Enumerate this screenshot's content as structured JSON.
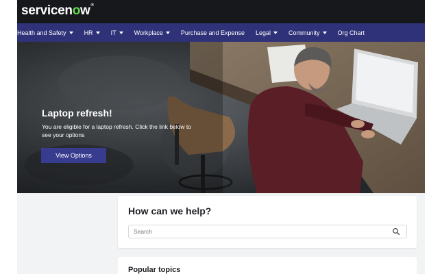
{
  "brand": {
    "name_prefix": "servicen",
    "name_o": "o",
    "name_suffix": "w",
    "mark": "®"
  },
  "nav": {
    "items": [
      {
        "label": "Health and Safety",
        "dropdown": true
      },
      {
        "label": "HR",
        "dropdown": true
      },
      {
        "label": "IT",
        "dropdown": true
      },
      {
        "label": "Workplace",
        "dropdown": true
      },
      {
        "label": "Purchase and Expense",
        "dropdown": false
      },
      {
        "label": "Legal",
        "dropdown": true
      },
      {
        "label": "Community",
        "dropdown": true
      },
      {
        "label": "Org Chart",
        "dropdown": false
      }
    ]
  },
  "hero": {
    "title": "Laptop refresh!",
    "text": "You are eligible for a laptop refresh. Click the link below to see your options",
    "button_label": "View Options"
  },
  "help": {
    "title": "How can we help?",
    "search_placeholder": "Search"
  },
  "topics": {
    "title": "Popular topics"
  },
  "colors": {
    "topbar": "#17181c",
    "nav": "#2f3278",
    "button": "#383c8e",
    "logo_accent": "#62d84e",
    "page_bg": "#f2f3f4"
  },
  "icons": {
    "search": "search-icon",
    "dropdown": "caret-down-icon"
  }
}
